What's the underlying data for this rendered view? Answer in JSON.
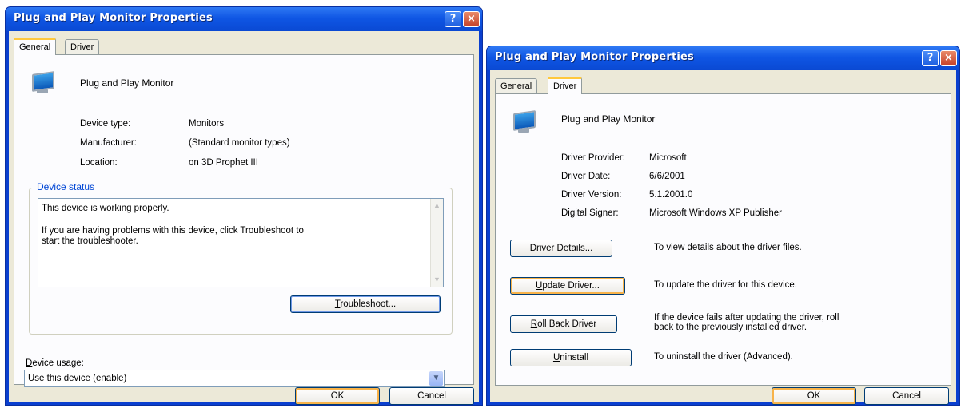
{
  "general": {
    "title": "Plug and Play Monitor Properties",
    "help_label": "?",
    "close_label": "×",
    "tabs": [
      {
        "label": "General"
      },
      {
        "label": "Driver"
      }
    ],
    "device_name": "Plug and Play Monitor",
    "props": [
      {
        "label": "Device type:",
        "value": "Monitors"
      },
      {
        "label": "Manufacturer:",
        "value": "(Standard monitor types)"
      },
      {
        "label": "Location:",
        "value": "on 3D Prophet III"
      }
    ],
    "status_group_title": "Device status",
    "status_line1": "This device is working properly.",
    "status_line2": "If you are having problems with this device, click Troubleshoot to",
    "status_line3": "start the troubleshooter.",
    "troubleshoot_first": "T",
    "troubleshoot_rest": "roubleshoot...",
    "usage_first": "D",
    "usage_rest": "evice usage:",
    "usage_value": "Use this device (enable)",
    "ok_label": "OK",
    "cancel_label": "Cancel"
  },
  "driver": {
    "title": "Plug and Play Monitor Properties",
    "help_label": "?",
    "close_label": "×",
    "tabs": [
      {
        "label": "General"
      },
      {
        "label": "Driver"
      }
    ],
    "device_name": "Plug and Play Monitor",
    "props": [
      {
        "label": "Driver Provider:",
        "value": "Microsoft"
      },
      {
        "label": "Driver Date:",
        "value": "6/6/2001"
      },
      {
        "label": "Driver Version:",
        "value": "5.1.2001.0"
      },
      {
        "label": "Digital Signer:",
        "value": "Microsoft Windows XP Publisher"
      }
    ],
    "buttons": [
      {
        "first": "D",
        "rest": "river Details...",
        "desc1": "To view details about the driver files.",
        "desc2": ""
      },
      {
        "first": "U",
        "rest": "pdate Driver...",
        "desc1": "To update the driver for this device.",
        "desc2": ""
      },
      {
        "first": "R",
        "rest": "oll Back Driver",
        "desc1": "If the device fails after updating the driver, roll",
        "desc2": "back to the previously installed driver."
      },
      {
        "first": "U",
        "rest": "ninstall",
        "desc1": "To uninstall the driver (Advanced).",
        "desc2": ""
      }
    ],
    "ok_label": "OK",
    "cancel_label": "Cancel"
  }
}
